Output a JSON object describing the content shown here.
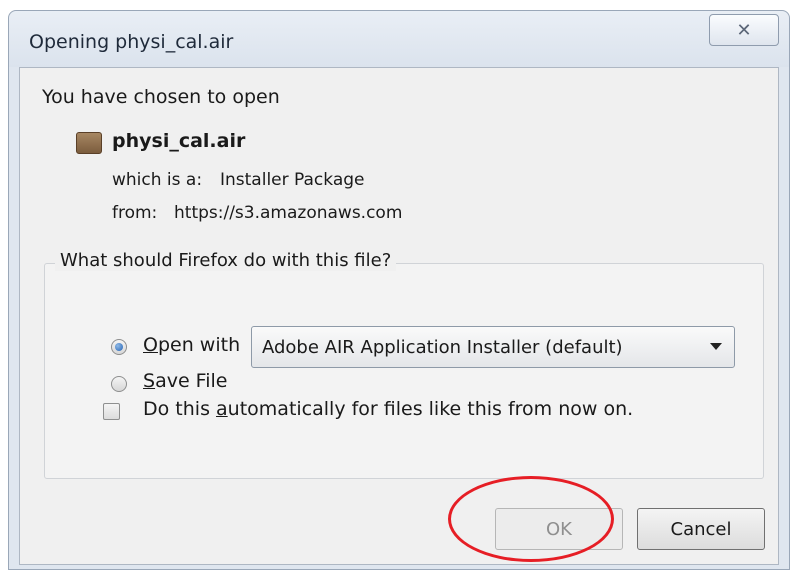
{
  "dialog": {
    "title": "Opening physi_cal.air",
    "close_icon": "close-icon",
    "chosen_text": "You have chosen to open",
    "file_icon": "file-icon",
    "file_name": "physi_cal.air",
    "type_label": "which is a:",
    "type_value": "Installer Package",
    "from_label": "from:",
    "from_value": "https://s3.amazonaws.com",
    "question": "What should Firefox do with this file?",
    "open_with": {
      "mnemonic": "O",
      "rest": "pen with",
      "selected": true
    },
    "application": "Adobe AIR Application Installer (default)",
    "save_file": {
      "mnemonic": "S",
      "rest": "ave File",
      "selected": false
    },
    "auto": {
      "before": "Do this ",
      "mnemonic": "a",
      "after": "utomatically for files like this from now on.",
      "checked": false
    },
    "ok_label": "OK",
    "cancel_label": "Cancel",
    "annotation_color": "#e61e25"
  }
}
